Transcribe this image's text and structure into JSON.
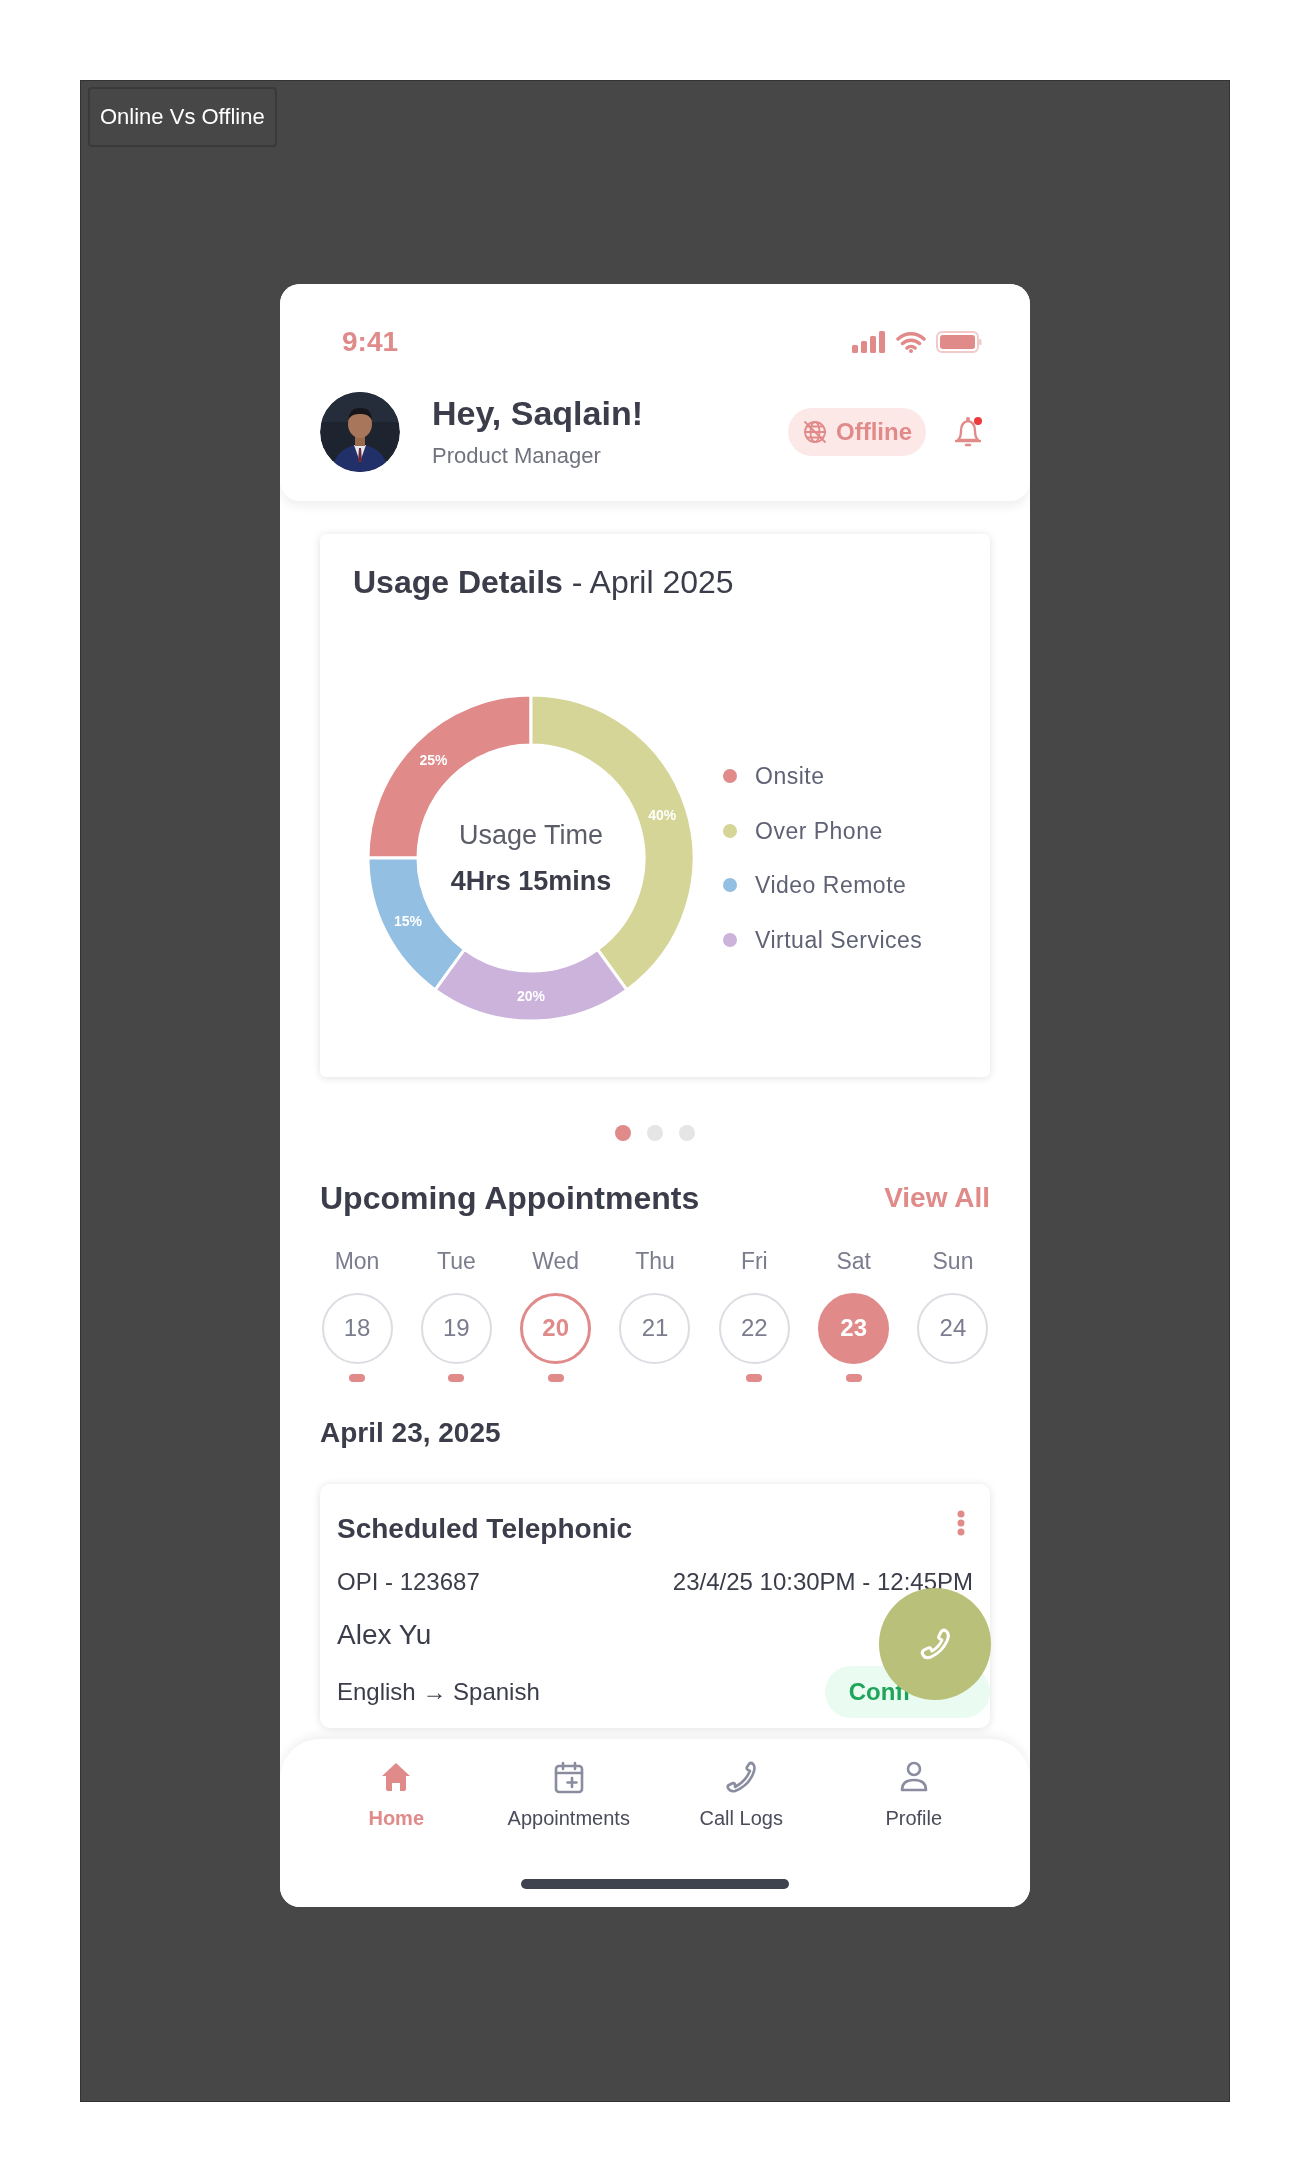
{
  "frame_label": "Online Vs Offline",
  "status_bar": {
    "time": "9:41"
  },
  "header": {
    "greeting": "Hey, Saqlain!",
    "role": "Product Manager",
    "status": {
      "label": "Offline",
      "online": false
    },
    "notifications": {
      "unread": true
    }
  },
  "usage_card": {
    "title": "**Usage Details** - April 2025",
    "center_label": "Usage Time",
    "center_value": "4Hrs 15mins",
    "legend": [
      {
        "color": "#e08a8a"
      },
      {
        "color": "#d4d597"
      },
      {
        "color": "#93bfe2"
      },
      {
        "color": "#cbb3dc"
      }
    ],
    "chart_data": {
      "type": "donut",
      "categories": [
        "Onsite",
        "Over Phone",
        "Video Remote",
        "Virtual Services"
      ],
      "series": [
        {
          "values": [
            25,
            40,
            15,
            20
          ]
        }
      ],
      "value_labels": [
        "25%",
        "40%",
        "15%",
        "20%"
      ]
    }
  },
  "pager": [
    {
      "selected": true
    },
    {
      "selected": false
    },
    {
      "selected": false
    }
  ],
  "appointments": {
    "title": "Upcoming Appointments",
    "view_all": "View All",
    "week": [
      {
        "day": "Mon",
        "date": "18",
        "selected": false,
        "today": false,
        "has_events": true
      },
      {
        "day": "Tue",
        "date": "19",
        "selected": false,
        "today": false,
        "has_events": true
      },
      {
        "day": "Wed",
        "date": "20",
        "selected": false,
        "today": true,
        "has_events": true
      },
      {
        "day": "Thu",
        "date": "21",
        "selected": false,
        "today": false,
        "has_events": false
      },
      {
        "day": "Fri",
        "date": "22",
        "selected": false,
        "today": false,
        "has_events": true
      },
      {
        "day": "Sat",
        "date": "23",
        "selected": true,
        "today": false,
        "has_events": true
      },
      {
        "day": "Sun",
        "date": "24",
        "selected": false,
        "today": false,
        "has_events": false
      }
    ],
    "date_heading": "April 23, 2025",
    "items": [
      {
        "title": "Scheduled Telephonic",
        "code": "OPI - 123687",
        "time": "23/4/25 10:30PM - 12:45PM",
        "name": "Alex Yu",
        "languages": "English → Spanish",
        "status": "Confi"
      }
    ]
  },
  "nav": [
    {
      "label": "Home",
      "kind": "home",
      "selected": true
    },
    {
      "label": "Appointments",
      "kind": "calendar",
      "selected": false
    },
    {
      "label": "Call Logs",
      "kind": "phone",
      "selected": false
    },
    {
      "label": "Profile",
      "kind": "person",
      "selected": false
    }
  ]
}
